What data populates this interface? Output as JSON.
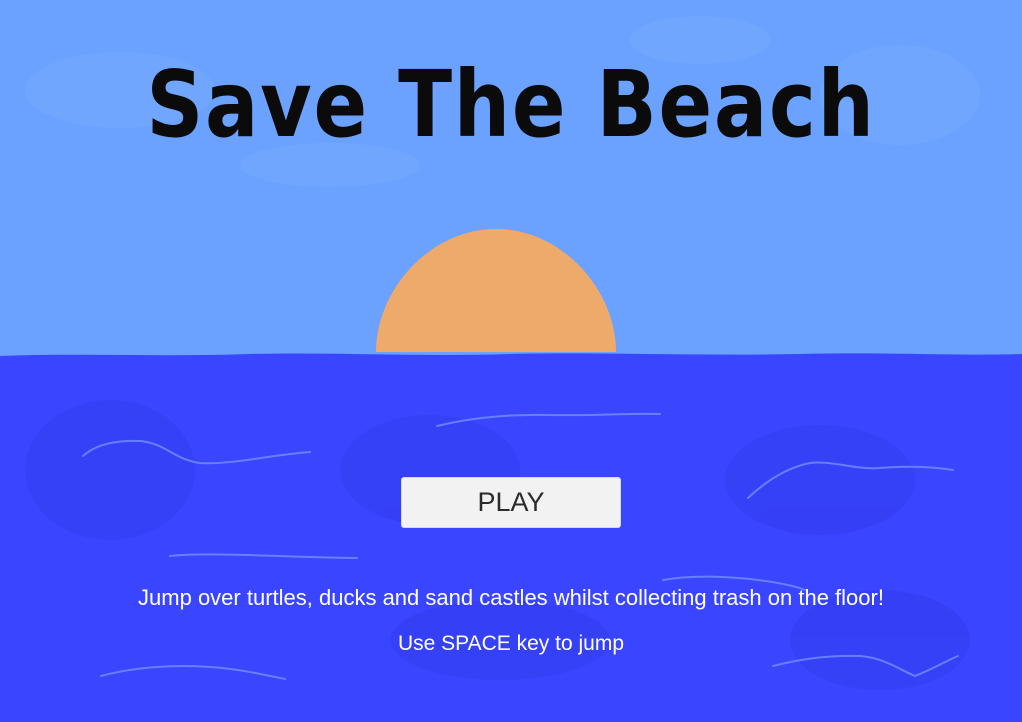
{
  "game": {
    "title": "Save The Beach",
    "play_label": "PLAY",
    "instructions": "Jump over turtles, ducks and sand castles whilst collecting trash on the floor!",
    "controls_hint": "Use SPACE key to jump"
  },
  "colors": {
    "sky": "#6ba2ff",
    "sea": "#3a45ff",
    "sun": "#eeaa6a",
    "wave": "#6f8bff",
    "title_text": "#0b0b0b",
    "button_bg": "#f2f2f2"
  },
  "icons": {
    "sun": "setting-sun-icon",
    "waves": "wave-scribble-icon"
  }
}
